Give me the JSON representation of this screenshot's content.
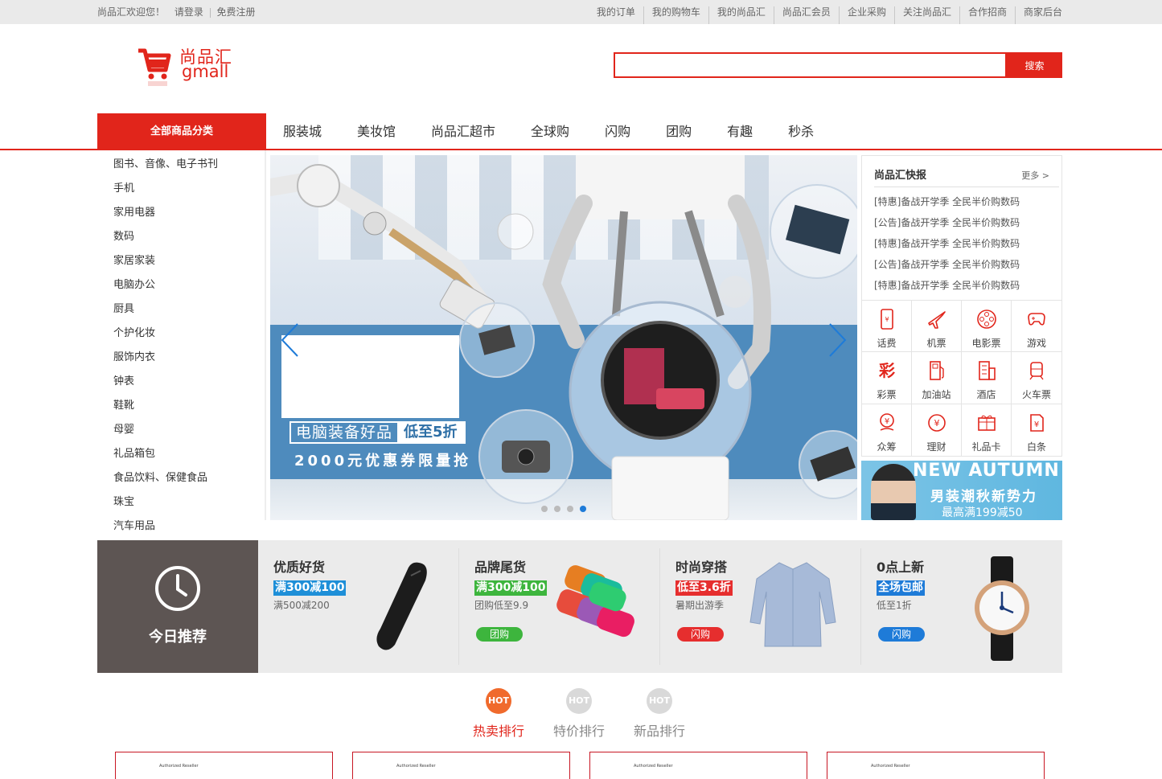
{
  "topbar": {
    "welcome": "尚品汇欢迎您！",
    "login": "请登录",
    "register": "免费注册",
    "links": [
      "我的订单",
      "我的购物车",
      "我的尚品汇",
      "尚品汇会员",
      "企业采购",
      "关注尚品汇",
      "合作招商",
      "商家后台"
    ]
  },
  "header": {
    "logo_cn": "尚品汇",
    "logo_en": "gmall",
    "search_value": "",
    "search_button": "搜索"
  },
  "nav": {
    "all_categories": "全部商品分类",
    "items": [
      "服装城",
      "美妆馆",
      "尚品汇超市",
      "全球购",
      "闪购",
      "团购",
      "有趣",
      "秒杀"
    ]
  },
  "categories": [
    "图书、音像、电子书刊",
    "手机",
    "家用电器",
    "数码",
    "家居家装",
    "电脑办公",
    "厨具",
    "个护化妆",
    "服饰内衣",
    "钟表",
    "鞋靴",
    "母婴",
    "礼品箱包",
    "食品饮料、保健食品",
    "珠宝",
    "汽车用品"
  ],
  "banner": {
    "promo_main": "电脑装备好品",
    "promo_discount": "低至5折",
    "promo_sub": "2000元优惠券限量抢",
    "slide_count": 4,
    "active_slide": 4
  },
  "news": {
    "title": "尚品汇快报",
    "more": "更多 >",
    "items": [
      "[特惠]备战开学季 全民半价购数码",
      "[公告]备战开学季 全民半价购数码",
      "[特惠]备战开学季 全民半价购数码",
      "[公告]备战开学季 全民半价购数码",
      "[特惠]备战开学季 全民半价购数码"
    ]
  },
  "services": [
    {
      "label": "话费",
      "icon": "phone-icon"
    },
    {
      "label": "机票",
      "icon": "airplane-icon"
    },
    {
      "label": "电影票",
      "icon": "film-reel-icon"
    },
    {
      "label": "游戏",
      "icon": "gamepad-icon"
    },
    {
      "label": "彩票",
      "icon": "lottery-icon"
    },
    {
      "label": "加油站",
      "icon": "gas-station-icon"
    },
    {
      "label": "酒店",
      "icon": "hotel-icon"
    },
    {
      "label": "火车票",
      "icon": "train-icon"
    },
    {
      "label": "众筹",
      "icon": "crowdfunding-icon"
    },
    {
      "label": "理财",
      "icon": "yuan-coin-icon"
    },
    {
      "label": "礼品卡",
      "icon": "gift-card-icon"
    },
    {
      "label": "白条",
      "icon": "credit-icon"
    }
  ],
  "side_ad": {
    "line1": "NEW AUTUMN",
    "line2": "男装潮秋新势力",
    "line3": "最高满199减50"
  },
  "today": {
    "label": "今日推荐",
    "items": [
      {
        "title": "优质好货",
        "tag": "满300减100",
        "tag_color": "#1e8fd8",
        "desc": "满500减200",
        "button": "",
        "button_color": ""
      },
      {
        "title": "品牌尾货",
        "tag": "满300减100",
        "tag_color": "#3db53d",
        "desc": "团购低至9.9",
        "button": "团购",
        "button_color": "#3db53d"
      },
      {
        "title": "时尚穿搭",
        "tag": "低至3.6折",
        "tag_color": "#e62e2e",
        "desc": "暑期出游季",
        "button": "闪购",
        "button_color": "#e62e2e"
      },
      {
        "title": "0点上新",
        "tag": "全场包邮",
        "tag_color": "#1e7bd8",
        "desc": "低至1折",
        "button": "闪购",
        "button_color": "#1e7bd8"
      }
    ]
  },
  "hot_tabs": [
    {
      "badge": "HOT",
      "label": "热卖排行",
      "active": true
    },
    {
      "badge": "HOT",
      "label": "特价排行",
      "active": false
    },
    {
      "badge": "HOT",
      "label": "新品排行",
      "active": false
    }
  ],
  "product_cards": [
    {
      "brand_text": "Authorized Reseller"
    },
    {
      "brand_text": "Authorized Reseller"
    },
    {
      "brand_text": "Authorized Reseller"
    },
    {
      "brand_text": "Authorized Reseller"
    }
  ],
  "colors": {
    "brand_red": "#e1251b",
    "hot_active": "#f06a2c",
    "hot_inactive": "#d9d9d9"
  }
}
